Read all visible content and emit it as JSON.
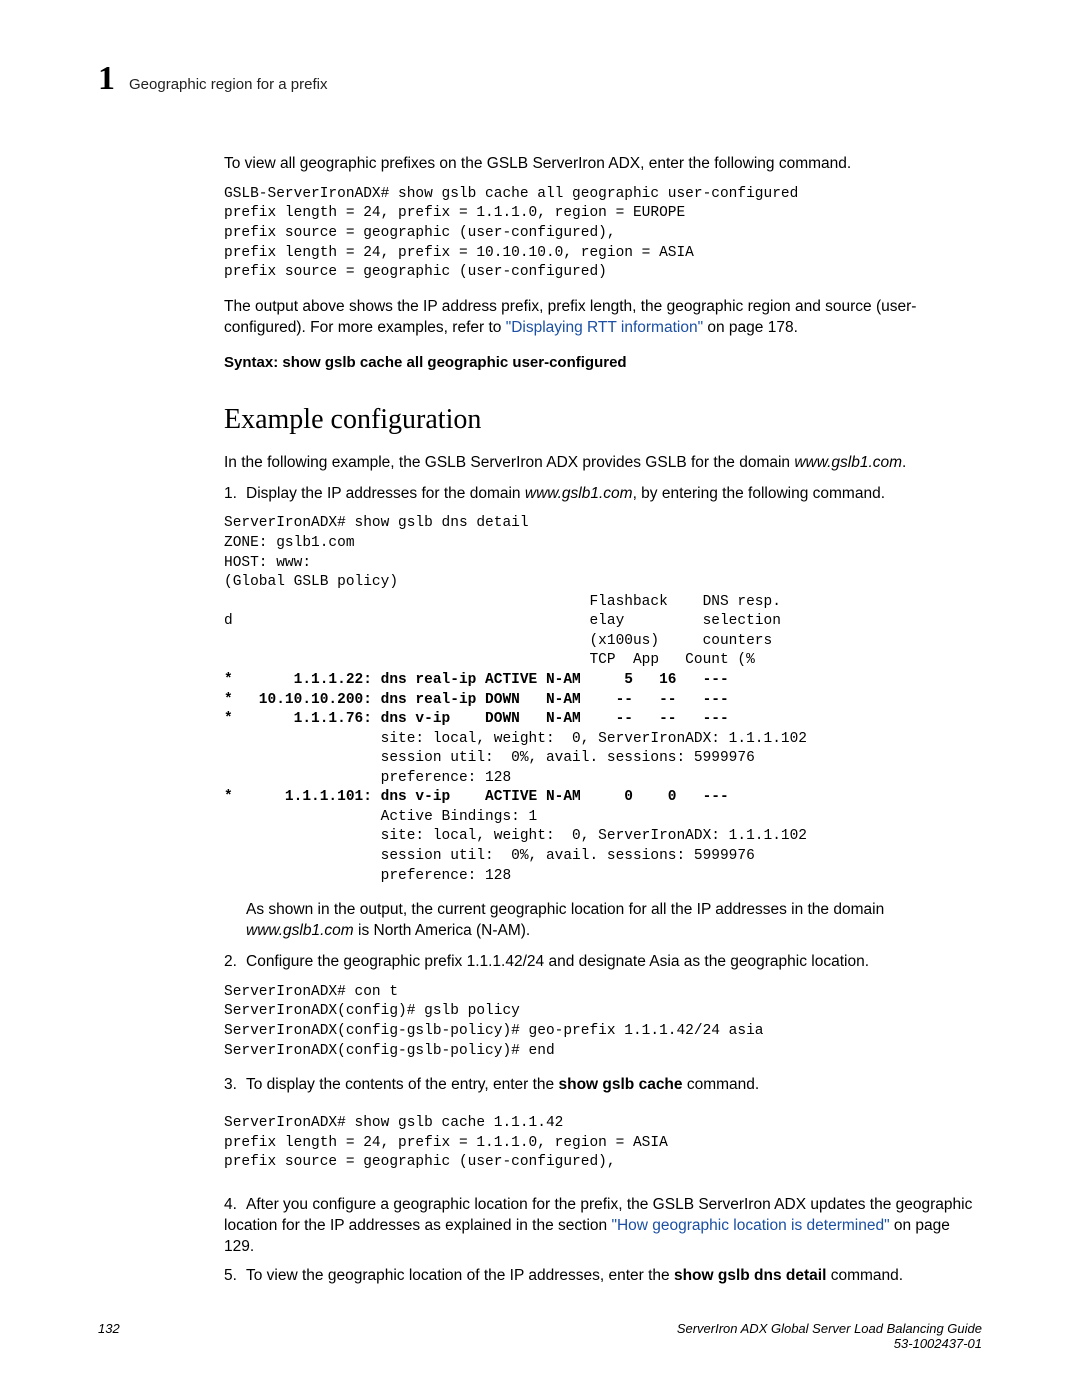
{
  "header": {
    "chapter_number": "1",
    "chapter_title": "Geographic region for a prefix"
  },
  "intro_para": "To view all geographic prefixes on the GSLB ServerIron ADX, enter the following command.",
  "code1": "GSLB-ServerIronADX# show gslb cache all geographic user-configured\nprefix length = 24, prefix = 1.1.1.0, region = EUROPE\nprefix source = geographic (user-configured),\nprefix length = 24, prefix = 10.10.10.0, region = ASIA\nprefix source = geographic (user-configured)",
  "after_code1_a": "The output above shows the IP address prefix, prefix length, the geographic region and source (user-configured). For more examples, refer to ",
  "after_code1_link": "\"Displaying RTT information\"",
  "after_code1_b": " on page 178.",
  "syntax_line": "Syntax:  show gslb cache all geographic user-configured",
  "section_heading": "Example configuration",
  "ex_intro_a": "In the following example, the GSLB ServerIron ADX provides GSLB for the domain ",
  "ex_intro_domain": "www.gslb1.com",
  "ex_intro_b": ".",
  "step1_a": "Display the IP addresses for the domain ",
  "step1_domain": "www.gslb1.com",
  "step1_b": ", by entering the following command.",
  "code2_pre": "ServerIronADX# show gslb dns detail\nZONE: gslb1.com\nHOST: www:\n(Global GSLB policy)\n                                          Flashback    DNS resp.\nd                                         elay         selection\n                                          (x100us)     counters\n                                          TCP  App   Count (%",
  "code2_row1": "*       1.1.1.22: dns real-ip ACTIVE N-AM     5   16   ---",
  "code2_row2": "*   10.10.10.200: dns real-ip DOWN   N-AM    --   --   ---",
  "code2_row3": "*       1.1.1.76: dns v-ip    DOWN   N-AM    --   --   ---",
  "code2_mid": "                  site: local, weight:  0, ServerIronADX: 1.1.1.102\n                  session util:  0%, avail. sessions: 5999976\n                  preference: 128",
  "code2_row4": "*      1.1.1.101: dns v-ip    ACTIVE N-AM     0    0   ---",
  "code2_tail": "                  Active Bindings: 1\n                  site: local, weight:  0, ServerIronADX: 1.1.1.102\n                  session util:  0%, avail. sessions: 5999976\n                  preference: 128",
  "after_code2_a": "As shown in the output, the current geographic location for all the IP addresses in the domain ",
  "after_code2_domain": "www.gslb1.com",
  "after_code2_b": " is North America (N-AM).",
  "step2": "Configure the geographic prefix 1.1.1.42/24 and designate Asia as the geographic location.",
  "code3": "ServerIronADX# con t\nServerIronADX(config)# gslb policy\nServerIronADX(config-gslb-policy)# geo-prefix 1.1.1.42/24 asia\nServerIronADX(config-gslb-policy)# end",
  "step3_a": "To display the contents of the entry, enter the ",
  "step3_bold": "show gslb cache",
  "step3_b": " command.",
  "code4": "ServerIronADX# show gslb cache 1.1.1.42\nprefix length = 24, prefix = 1.1.1.0, region = ASIA\nprefix source = geographic (user-configured),",
  "step4_a": "After you configure a geographic location for the prefix, the GSLB ServerIron ADX updates the geographic location for the IP addresses as explained in the section ",
  "step4_link": "\"How geographic location is determined\"",
  "step4_b": " on page 129.",
  "step5_a": "To view the geographic location of the IP addresses, enter the ",
  "step5_bold": "show gslb dns detail",
  "step5_b": " command.",
  "footer": {
    "page_number": "132",
    "doc_title": "ServerIron ADX Global Server Load Balancing Guide",
    "doc_id": "53-1002437-01"
  }
}
